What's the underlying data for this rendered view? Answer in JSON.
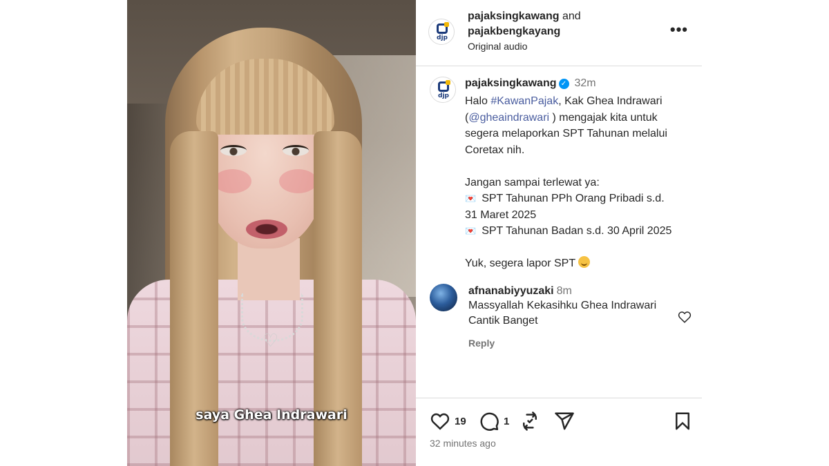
{
  "video": {
    "caption": "saya Ghea Indrawari"
  },
  "header": {
    "user1": "pajaksingkawang",
    "connector": "and",
    "user2": "pajakbengkayang",
    "audio": "Original audio",
    "avatar_label": "djp",
    "more_icon": "more-horizontal-icon"
  },
  "post": {
    "username": "pajaksingkawang",
    "verified_icon": "verified-badge-icon",
    "time": "32m",
    "avatar_label": "djp",
    "line1_prefix": "Halo ",
    "hashtag": "#KawanPajak",
    "line1_suffix": ", Kak Ghea Indrawari",
    "line2_prefix": "(",
    "mention": "@gheaindrawari",
    "line2_suffix": " ) mengajak kita  untuk",
    "line3": "segera melaporkan SPT Tahunan melalui",
    "line4": "Coretax nih.",
    "line5": "Jangan sampai terlewat ya:",
    "bullet1a": "SPT Tahunan PPh Orang Pribadi  s.d.",
    "bullet1b": "31 Maret 2025",
    "bullet2": "SPT Tahunan Badan s.d. 30 April 2025",
    "closing": "Yuk, segera lapor SPT",
    "bullet_emoji": "💌"
  },
  "comment": {
    "username": "afnanabiyyuzaki",
    "time": "8m",
    "text_line1": "Massyallah Kekasihku Ghea Indrawari",
    "text_line2": "Cantik Banget",
    "reply_label": "Reply"
  },
  "actions": {
    "like_count": "19",
    "comment_count": "1",
    "timestamp": "32 minutes ago"
  },
  "colors": {
    "link": "#4a5d9f",
    "muted": "#737373",
    "text": "#262626",
    "verified": "#0095f6",
    "border": "#dbdbdb"
  }
}
